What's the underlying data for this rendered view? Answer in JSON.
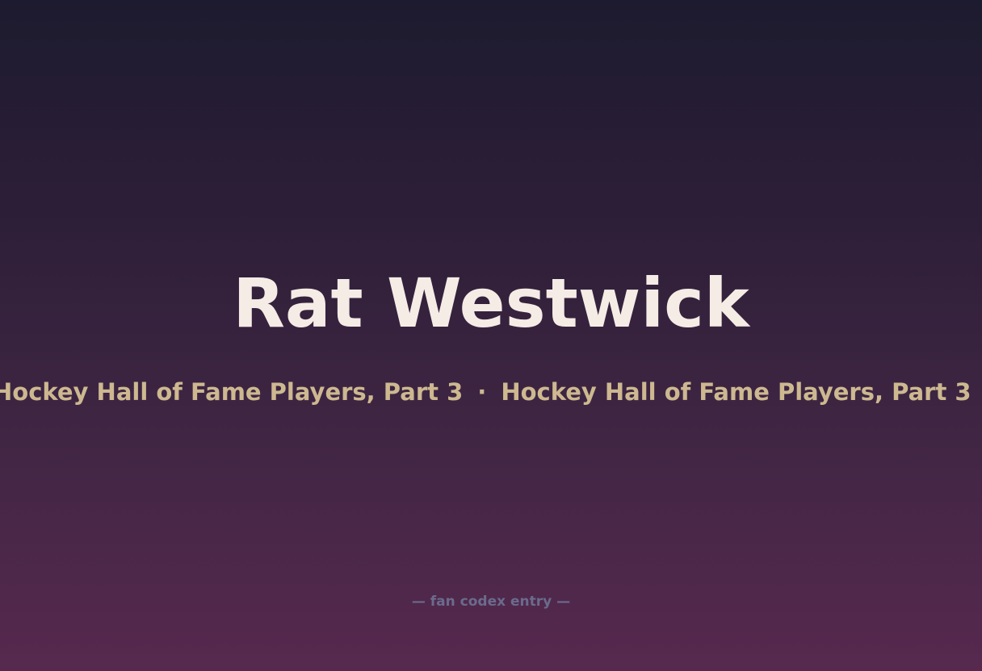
{
  "title": "Rat Westwick",
  "subtitle": {
    "text": "Hockey Hall of Fame Players, Part 3",
    "separator": "·"
  },
  "footer": "— fan codex entry —",
  "colors": {
    "background_top": "#1d1b2f",
    "background_bottom": "#57294f",
    "title": "#f6ece6",
    "subtitle": "#cdb890",
    "footer": "#6b6b8c"
  }
}
